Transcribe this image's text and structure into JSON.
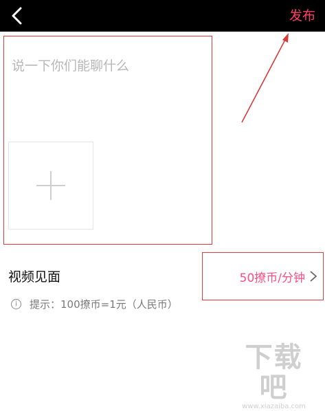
{
  "header": {
    "back_icon": "chevron-left-icon",
    "publish_label": "发布",
    "background": "#000000",
    "accent": "#ff3b6b"
  },
  "composer": {
    "placeholder": "说一下你们能聊什么",
    "value": "",
    "add_icon": "plus-icon"
  },
  "video_meeting": {
    "title": "视频见面",
    "price": "50撩币/分钟",
    "chevron_icon": "chevron-right-icon",
    "price_color": "#ff4d7f"
  },
  "tip": {
    "icon": "info-icon",
    "text": "提示：100撩币=1元（人民币）"
  },
  "watermark": {
    "main": "下载吧",
    "sub": "www.xiazaiba.com"
  }
}
